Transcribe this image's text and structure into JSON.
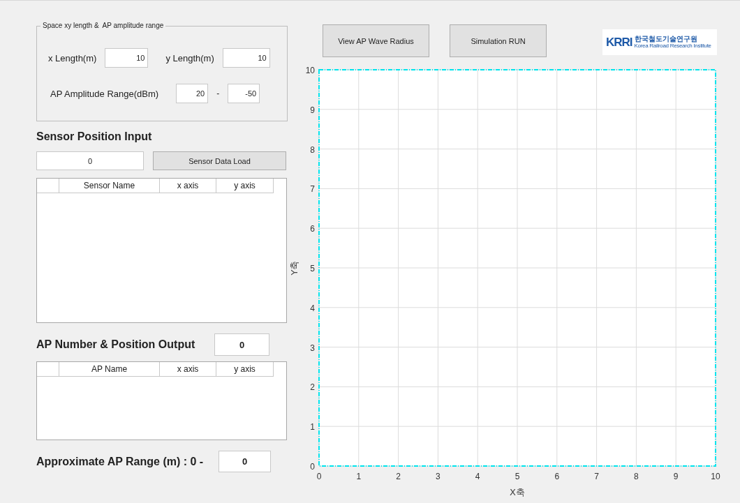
{
  "space_group": {
    "title": "Space xy length &  AP amplitude range",
    "x_length": {
      "label": "x Length(m)",
      "value": "10"
    },
    "y_length": {
      "label": "y Length(m)",
      "value": "10"
    },
    "amplitude": {
      "label": "AP Amplitude Range(dBm)",
      "from": "20",
      "separator": "-",
      "to": "-50"
    }
  },
  "sensor_input": {
    "heading": "Sensor Position Input",
    "count_value": "0",
    "load_button": "Sensor Data Load",
    "columns": [
      "Sensor Name",
      "x axis",
      "y axis"
    ]
  },
  "ap_output": {
    "heading": "AP Number & Position Output",
    "count_value": "0",
    "columns": [
      "AP Name",
      "x axis",
      "y axis"
    ]
  },
  "ap_range": {
    "label": "Approximate AP Range (m) : 0 -",
    "value": "0"
  },
  "toolbar": {
    "buttons": [
      "View AP Wave Radius",
      "Simulation RUN"
    ]
  },
  "logo": {
    "mark": "KRRI",
    "name": "한국철도기술연구원",
    "subtitle": "Korea Railroad Research Institute"
  },
  "plot": {
    "chart_data": {
      "type": "line",
      "grid": true,
      "xlabel": "X축",
      "ylabel": "Y축",
      "xlim": [
        0,
        10
      ],
      "ylim": [
        0,
        10
      ],
      "xticks": [
        0,
        1,
        2,
        3,
        4,
        5,
        6,
        7,
        8,
        9,
        10
      ],
      "yticks": [
        0,
        1,
        2,
        3,
        4,
        5,
        6,
        7,
        8,
        9,
        10
      ]
    }
  }
}
